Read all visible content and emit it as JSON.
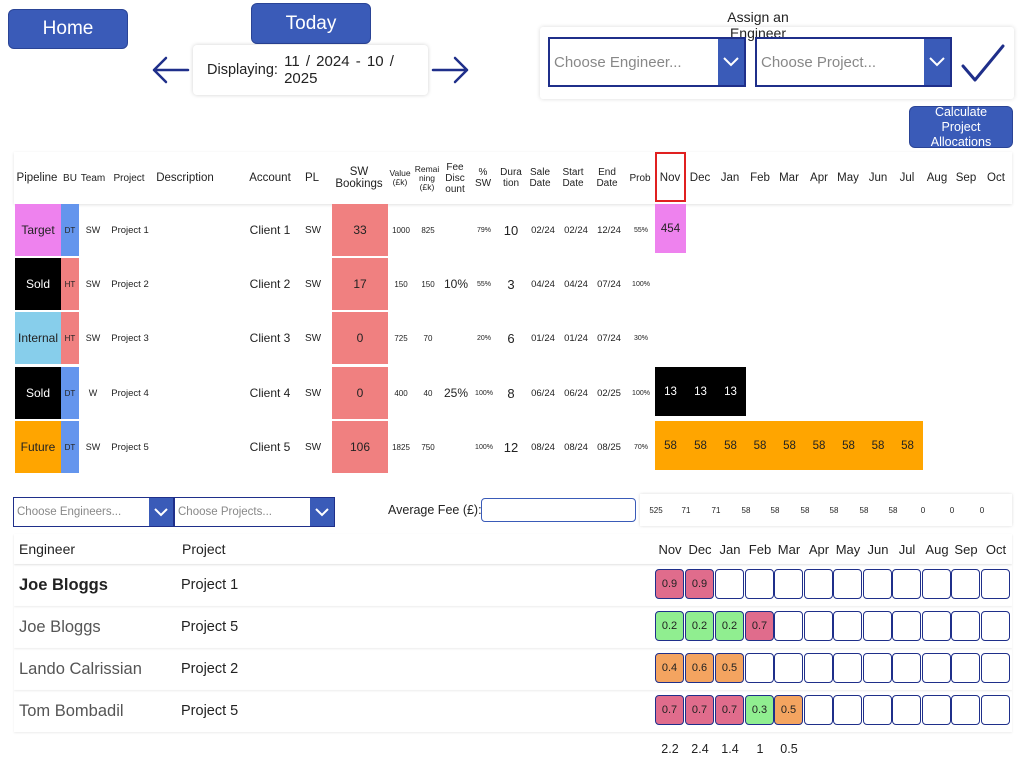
{
  "nav": {
    "home_label": "Home",
    "today_label": "Today",
    "displaying_label": "Displaying:",
    "displaying_value": "11 / 2024  - 10 / 2025"
  },
  "assign": {
    "title": "Assign an Engineer",
    "engineer_placeholder": "Choose Engineer...",
    "project_placeholder": "Choose Project...",
    "calculate_label": "Calculate Project Allocations"
  },
  "colors": {
    "accent": "#3a5bb8",
    "border_dark": "#1f2f8a",
    "highlight": "#e02020",
    "sw_bookings": "#f08080"
  },
  "table_header": {
    "pipeline": "Pipeline",
    "bu": "BU",
    "team": "Team",
    "project": "Project",
    "description": "Description",
    "account": "Account",
    "pl": "PL",
    "sw_bookings": "SW Bookings",
    "value": "Value (£k)",
    "remaining": "Remai ning (£k)",
    "fee_discount": "Fee Disc ount",
    "pct_sw": "% SW",
    "duration": "Dura tion",
    "sale_date": "Sale Date",
    "start_date": "Start Date",
    "end_date": "End Date",
    "prob": "Prob"
  },
  "months": [
    "Nov",
    "Dec",
    "Jan",
    "Feb",
    "Mar",
    "Apr",
    "May",
    "Jun",
    "Jul",
    "Aug",
    "Sep",
    "Oct"
  ],
  "projects": [
    {
      "pipeline": "Target",
      "pipeline_color": "#ee82ee",
      "pipeline_text": "#222222",
      "bu": "DT",
      "bu_color": "#6495ed",
      "team": "SW",
      "project": "Project 1",
      "description": "",
      "account": "Client 1",
      "pl": "SW",
      "sw_bookings": "33",
      "value": "1000",
      "remaining": "825",
      "fee_discount": "",
      "pct_sw": "79%",
      "duration": "10",
      "sale_date": "02/24",
      "start_date": "02/24",
      "end_date": "12/24",
      "prob": "55%",
      "month_values": [
        "454"
      ],
      "month_color": "#ee82ee",
      "month_text": "#222222"
    },
    {
      "pipeline": "Sold",
      "pipeline_color": "#000000",
      "pipeline_text": "#ffffff",
      "bu": "HT",
      "bu_color": "#f08080",
      "team": "SW",
      "project": "Project 2",
      "description": "",
      "account": "Client 2",
      "pl": "SW",
      "sw_bookings": "17",
      "value": "150",
      "remaining": "150",
      "fee_discount": "10%",
      "pct_sw": "55%",
      "duration": "3",
      "sale_date": "04/24",
      "start_date": "04/24",
      "end_date": "07/24",
      "prob": "100%",
      "month_values": [],
      "month_color": "#000000",
      "month_text": "#ffffff"
    },
    {
      "pipeline": "Internal",
      "pipeline_color": "#87ceeb",
      "pipeline_text": "#222222",
      "bu": "HT",
      "bu_color": "#f08080",
      "team": "SW",
      "project": "Project 3",
      "description": "",
      "account": "Client 3",
      "pl": "SW",
      "sw_bookings": "0",
      "value": "725",
      "remaining": "70",
      "fee_discount": "",
      "pct_sw": "20%",
      "duration": "6",
      "sale_date": "01/24",
      "start_date": "01/24",
      "end_date": "07/24",
      "prob": "30%",
      "month_values": [],
      "month_color": "#87ceeb",
      "month_text": "#222222"
    },
    {
      "pipeline": "Sold",
      "pipeline_color": "#000000",
      "pipeline_text": "#ffffff",
      "bu": "DT",
      "bu_color": "#6495ed",
      "team": "W",
      "project": "Project 4",
      "description": "",
      "account": "Client 4",
      "pl": "SW",
      "sw_bookings": "0",
      "value": "400",
      "remaining": "40",
      "fee_discount": "25%",
      "pct_sw": "100%",
      "duration": "8",
      "sale_date": "06/24",
      "start_date": "06/24",
      "end_date": "02/25",
      "prob": "100%",
      "month_values": [
        "13",
        "13",
        "13"
      ],
      "month_color": "#000000",
      "month_text": "#ffffff"
    },
    {
      "pipeline": "Future",
      "pipeline_color": "#ffa500",
      "pipeline_text": "#222222",
      "bu": "DT",
      "bu_color": "#6495ed",
      "team": "SW",
      "project": "Project 5",
      "description": "",
      "account": "Client 5",
      "pl": "SW",
      "sw_bookings": "106",
      "value": "1825",
      "remaining": "750",
      "fee_discount": "",
      "pct_sw": "100%",
      "duration": "12",
      "sale_date": "08/24",
      "start_date": "08/24",
      "end_date": "08/25",
      "prob": "70%",
      "month_values": [
        "58",
        "58",
        "58",
        "58",
        "58",
        "58",
        "58",
        "58",
        "58"
      ],
      "month_color": "#ffa500",
      "month_text": "#222222"
    }
  ],
  "filters": {
    "engineers_placeholder": "Choose Engineers...",
    "projects_placeholder": "Choose Projects...",
    "average_fee_label": "Average Fee (£):",
    "average_fee_value": ""
  },
  "monthly_totals": [
    "525",
    "71",
    "71",
    "58",
    "58",
    "58",
    "58",
    "58",
    "58",
    "0",
    "0",
    "0"
  ],
  "allocation_header": {
    "engineer": "Engineer",
    "project": "Project"
  },
  "allocations": [
    {
      "engineer": "Joe Bloggs",
      "bold": true,
      "project": "Project 1",
      "cells": [
        {
          "v": "0.9",
          "c": "#e06c8c"
        },
        {
          "v": "0.9",
          "c": "#e06c8c"
        }
      ]
    },
    {
      "engineer": "Joe Bloggs",
      "bold": false,
      "project": "Project 5",
      "cells": [
        {
          "v": "0.2",
          "c": "#90ee90"
        },
        {
          "v": "0.2",
          "c": "#90ee90"
        },
        {
          "v": "0.2",
          "c": "#90ee90"
        },
        {
          "v": "0.7",
          "c": "#e06c8c"
        }
      ]
    },
    {
      "engineer": "Lando Calrissian",
      "bold": false,
      "project": "Project 2",
      "cells": [
        {
          "v": "0.4",
          "c": "#f4a460"
        },
        {
          "v": "0.6",
          "c": "#f4a460"
        },
        {
          "v": "0.5",
          "c": "#f4a460"
        }
      ]
    },
    {
      "engineer": "Tom Bombadil",
      "bold": false,
      "project": "Project 5",
      "cells": [
        {
          "v": "0.7",
          "c": "#e06c8c"
        },
        {
          "v": "0.7",
          "c": "#e06c8c"
        },
        {
          "v": "0.7",
          "c": "#e06c8c"
        },
        {
          "v": "0.3",
          "c": "#90ee90"
        },
        {
          "v": "0.5",
          "c": "#f4a460"
        }
      ]
    }
  ],
  "allocation_sums": [
    "2.2",
    "2.4",
    "1.4",
    "1",
    "0.5"
  ]
}
